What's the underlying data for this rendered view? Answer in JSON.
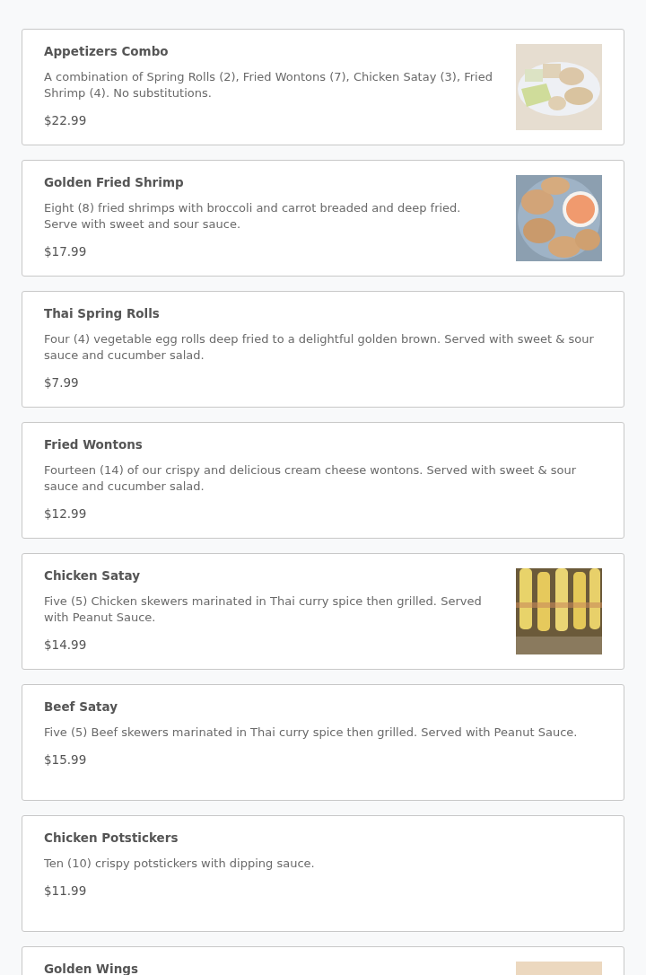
{
  "menu_items": [
    {
      "name": "Appetizers Combo",
      "description": "A combination of Spring Rolls (2), Fried Wontons (7), Chicken Satay (3), Fried Shrimp (4). No substitutions.",
      "price": "$22.99"
    },
    {
      "name": "Golden Fried Shrimp",
      "description": "Eight (8) fried shrimps with broccoli and carrot breaded and deep fried. Serve with sweet and sour sauce.",
      "price": "$17.99"
    },
    {
      "name": "Thai Spring Rolls",
      "description": "Four (4) vegetable egg rolls deep fried to a delightful golden brown. Served with sweet & sour sauce and cucumber salad.",
      "price": "$7.99"
    },
    {
      "name": "Fried Wontons",
      "description": "Fourteen (14) of our crispy and delicious cream cheese wontons. Served with sweet & sour sauce and cucumber salad.",
      "price": "$12.99"
    },
    {
      "name": "Chicken Satay",
      "description": "Five (5) Chicken skewers marinated in Thai curry spice then grilled. Served with Peanut Sauce.",
      "price": "$14.99"
    },
    {
      "name": "Beef Satay",
      "description": "Five (5) Beef skewers marinated in Thai curry spice then grilled. Served with Peanut Sauce.",
      "price": "$15.99"
    },
    {
      "name": "Chicken Potstickers",
      "description": "Ten (10) crispy potstickers with dipping sauce.",
      "price": "$11.99"
    },
    {
      "name": "Golden Wings"
    }
  ]
}
